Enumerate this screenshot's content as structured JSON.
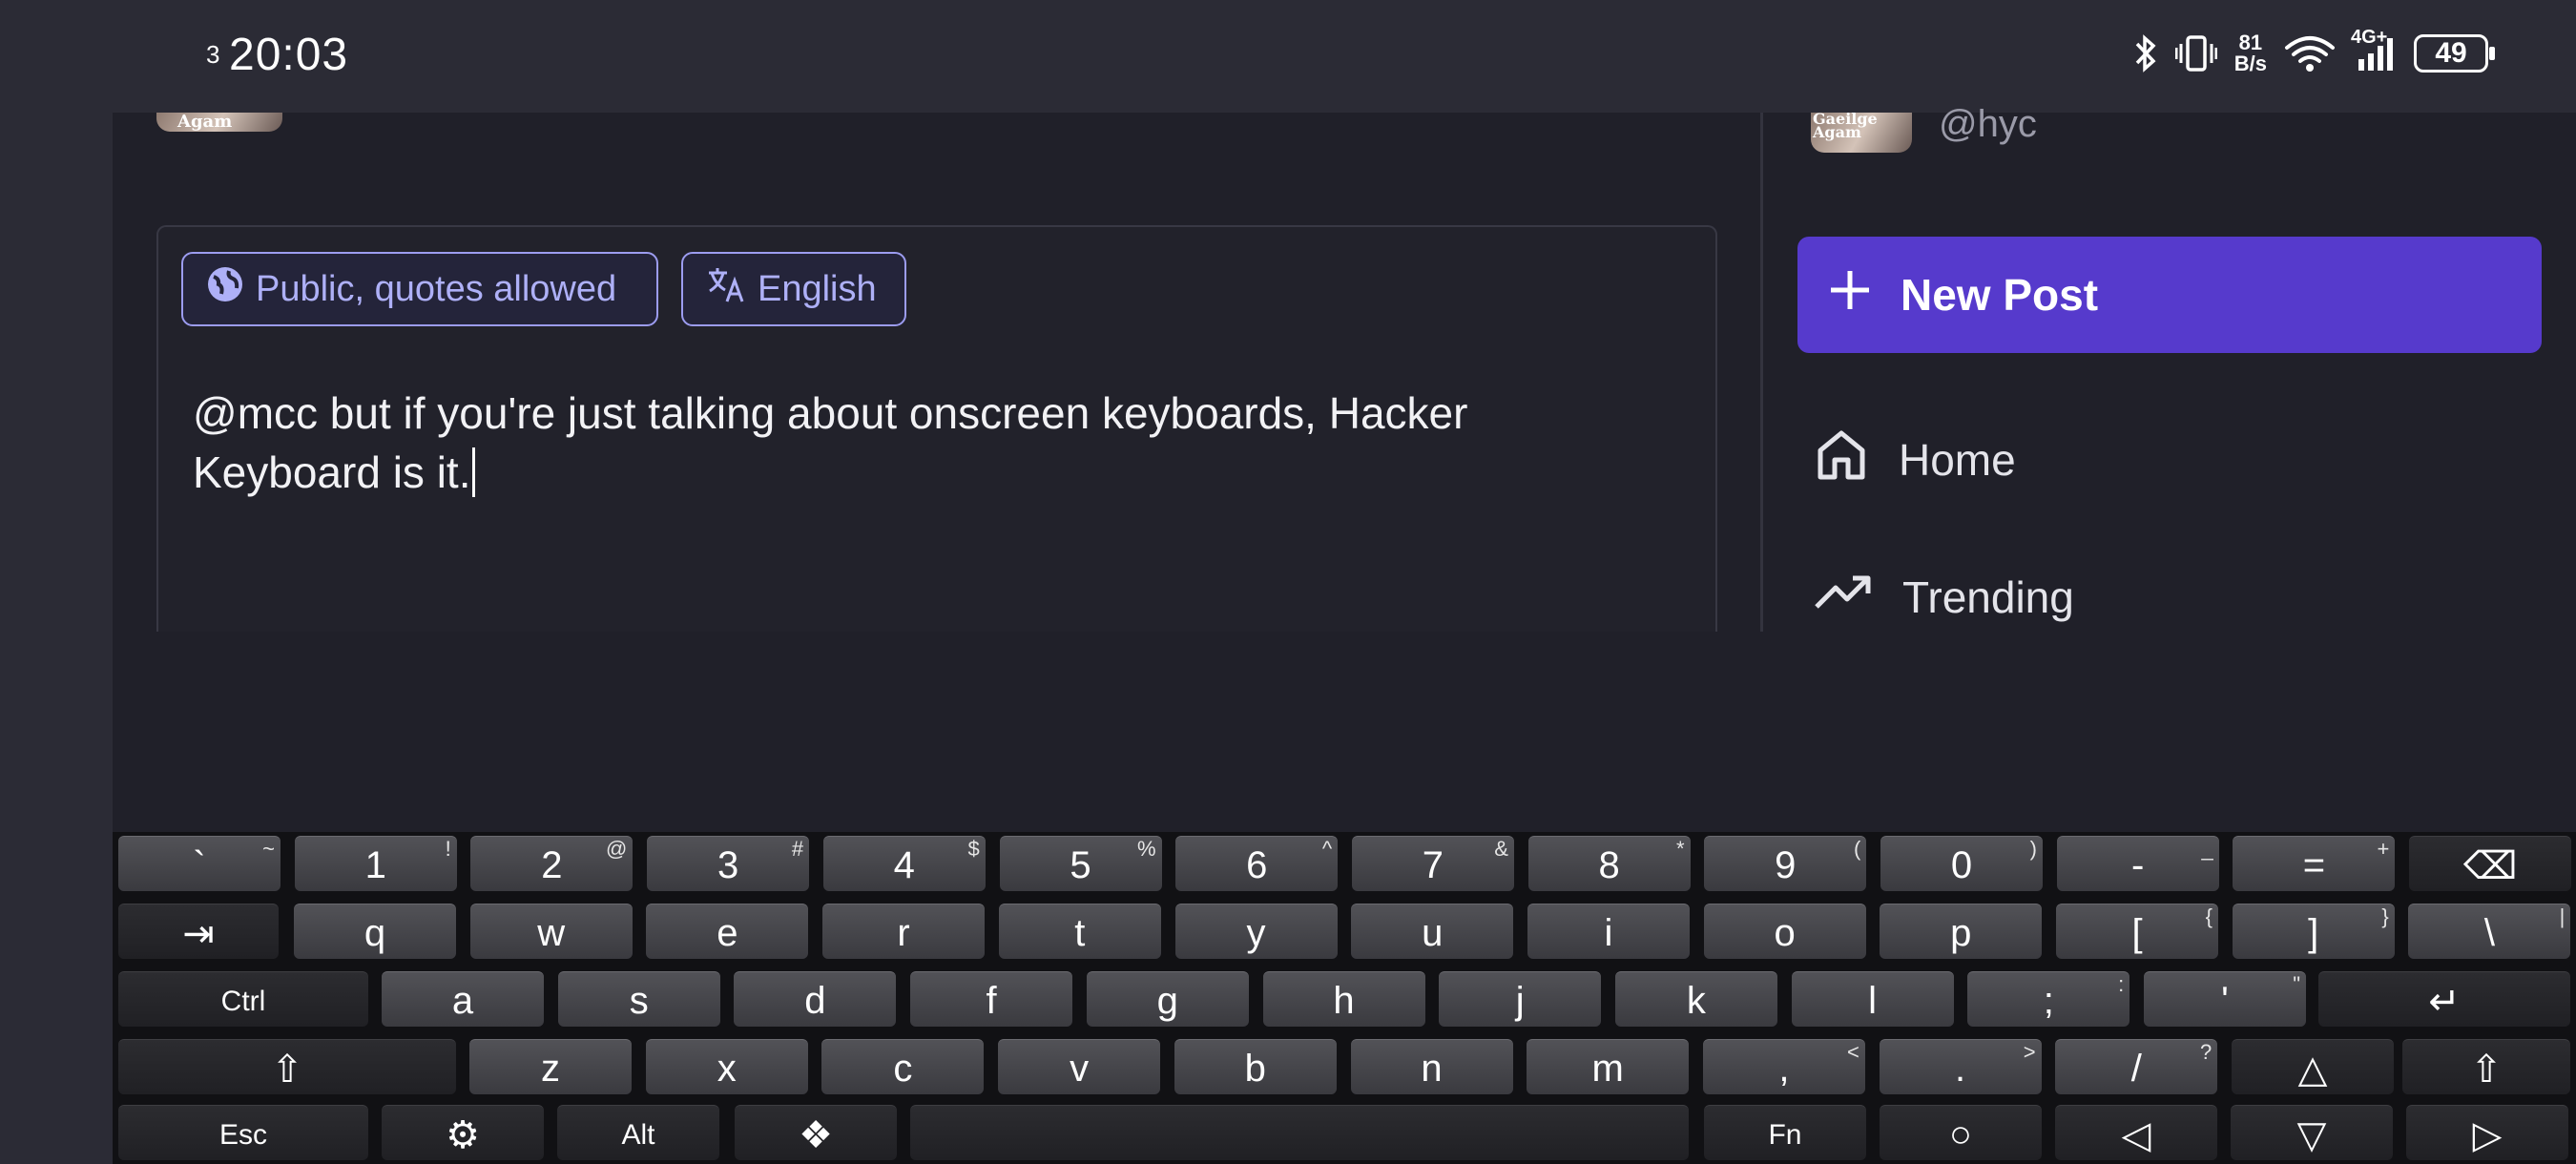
{
  "status_bar": {
    "notification_count": "3",
    "time": "20:03",
    "net_speed_value": "81",
    "net_speed_unit": "B/s",
    "network": "4G+",
    "battery": "49"
  },
  "top_avatar_text": "Agam",
  "sidebar": {
    "avatar_text_1": "Gaeilge",
    "avatar_text_2": "Agam",
    "handle": "@hyc",
    "new_post_label": "New Post",
    "nav": [
      {
        "label": "Home",
        "icon": "home-icon"
      },
      {
        "label": "Trending",
        "icon": "trending-icon"
      }
    ]
  },
  "composer": {
    "visibility_label": "Public, quotes allowed",
    "language_label": "English",
    "text": "@mcc but if you're just talking about onscreen keyboards, Hacker\nKeyboard is it."
  },
  "colors": {
    "accent": "#563acc",
    "chip_border": "#9c9cf0",
    "background": "#202029"
  },
  "keyboard": {
    "rows": [
      [
        {
          "label": "`",
          "sub": "~"
        },
        {
          "label": "1",
          "sub": "!"
        },
        {
          "label": "2",
          "sub": "@"
        },
        {
          "label": "3",
          "sub": "#"
        },
        {
          "label": "4",
          "sub": "$"
        },
        {
          "label": "5",
          "sub": "%"
        },
        {
          "label": "6",
          "sub": "^"
        },
        {
          "label": "7",
          "sub": "&"
        },
        {
          "label": "8",
          "sub": "*"
        },
        {
          "label": "9",
          "sub": "("
        },
        {
          "label": "0",
          "sub": ")"
        },
        {
          "label": "-",
          "sub": "_"
        },
        {
          "label": "=",
          "sub": "+"
        },
        {
          "label": "⌫",
          "sub": ""
        }
      ],
      [
        {
          "label": "⇥",
          "sub": ""
        },
        {
          "label": "q",
          "sub": ""
        },
        {
          "label": "w",
          "sub": ""
        },
        {
          "label": "e",
          "sub": ""
        },
        {
          "label": "r",
          "sub": ""
        },
        {
          "label": "t",
          "sub": ""
        },
        {
          "label": "y",
          "sub": ""
        },
        {
          "label": "u",
          "sub": ""
        },
        {
          "label": "i",
          "sub": ""
        },
        {
          "label": "o",
          "sub": ""
        },
        {
          "label": "p",
          "sub": ""
        },
        {
          "label": "[",
          "sub": "{"
        },
        {
          "label": "]",
          "sub": "}"
        },
        {
          "label": "\\",
          "sub": "|"
        }
      ],
      [
        {
          "label": "Ctrl",
          "sub": ""
        },
        {
          "label": "a",
          "sub": ""
        },
        {
          "label": "s",
          "sub": ""
        },
        {
          "label": "d",
          "sub": ""
        },
        {
          "label": "f",
          "sub": ""
        },
        {
          "label": "g",
          "sub": ""
        },
        {
          "label": "h",
          "sub": ""
        },
        {
          "label": "j",
          "sub": ""
        },
        {
          "label": "k",
          "sub": ""
        },
        {
          "label": "l",
          "sub": ""
        },
        {
          "label": ";",
          "sub": ":"
        },
        {
          "label": "'",
          "sub": "\""
        },
        {
          "label": "↵",
          "sub": ""
        }
      ],
      [
        {
          "label": "⇧",
          "sub": ""
        },
        {
          "label": "z",
          "sub": ""
        },
        {
          "label": "x",
          "sub": ""
        },
        {
          "label": "c",
          "sub": ""
        },
        {
          "label": "v",
          "sub": ""
        },
        {
          "label": "b",
          "sub": ""
        },
        {
          "label": "n",
          "sub": ""
        },
        {
          "label": "m",
          "sub": ""
        },
        {
          "label": ",",
          "sub": "<"
        },
        {
          "label": ".",
          "sub": ">"
        },
        {
          "label": "/",
          "sub": "?"
        },
        {
          "label": "△",
          "sub": ""
        },
        {
          "label": "⇧",
          "sub": ""
        }
      ],
      [
        {
          "label": "Esc",
          "sub": ""
        },
        {
          "label": "⚙",
          "sub": ""
        },
        {
          "label": "Alt",
          "sub": ""
        },
        {
          "label": "❖",
          "sub": ""
        },
        {
          "label": "",
          "sub": ""
        },
        {
          "label": "Fn",
          "sub": ""
        },
        {
          "label": "○",
          "sub": ""
        },
        {
          "label": "◁",
          "sub": ""
        },
        {
          "label": "▽",
          "sub": ""
        },
        {
          "label": "▷",
          "sub": ""
        }
      ]
    ]
  }
}
